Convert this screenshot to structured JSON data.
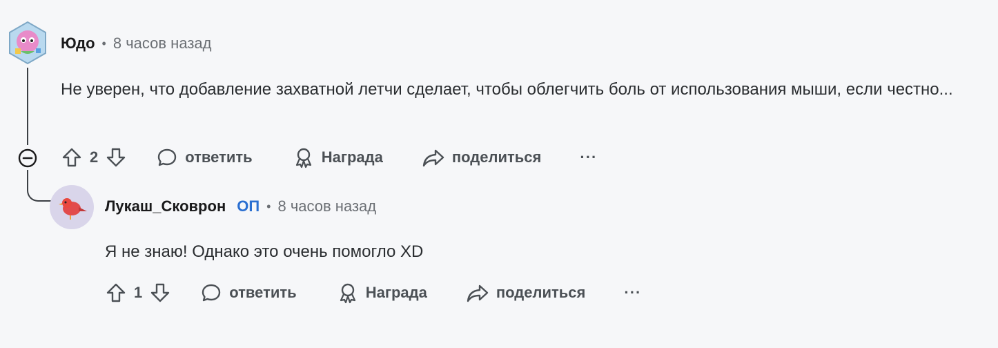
{
  "comments": [
    {
      "author": "Юдо",
      "separator": "•",
      "time": "8 часов назад",
      "body": "Не уверен, что добавление захватной летчи сделает, чтобы облегчить боль от использования мыши, если честно...",
      "votes": "2",
      "actions": {
        "reply": "ответить",
        "award": "Награда",
        "share": "поделиться",
        "more": "···"
      }
    },
    {
      "author": "Лукаш_Сковрон",
      "op_badge": "ОП",
      "separator": "•",
      "time": "8 часов назад",
      "body": "Я не знаю! Однако это очень помогло XD",
      "votes": "1",
      "actions": {
        "reply": "ответить",
        "award": "Награда",
        "share": "поделиться",
        "more": "···"
      }
    }
  ],
  "colors": {
    "background": "#f6f7f9",
    "thread_line": "#3b3f44",
    "op_badge": "#2a6fd1",
    "meta_text": "#6b6f74"
  }
}
